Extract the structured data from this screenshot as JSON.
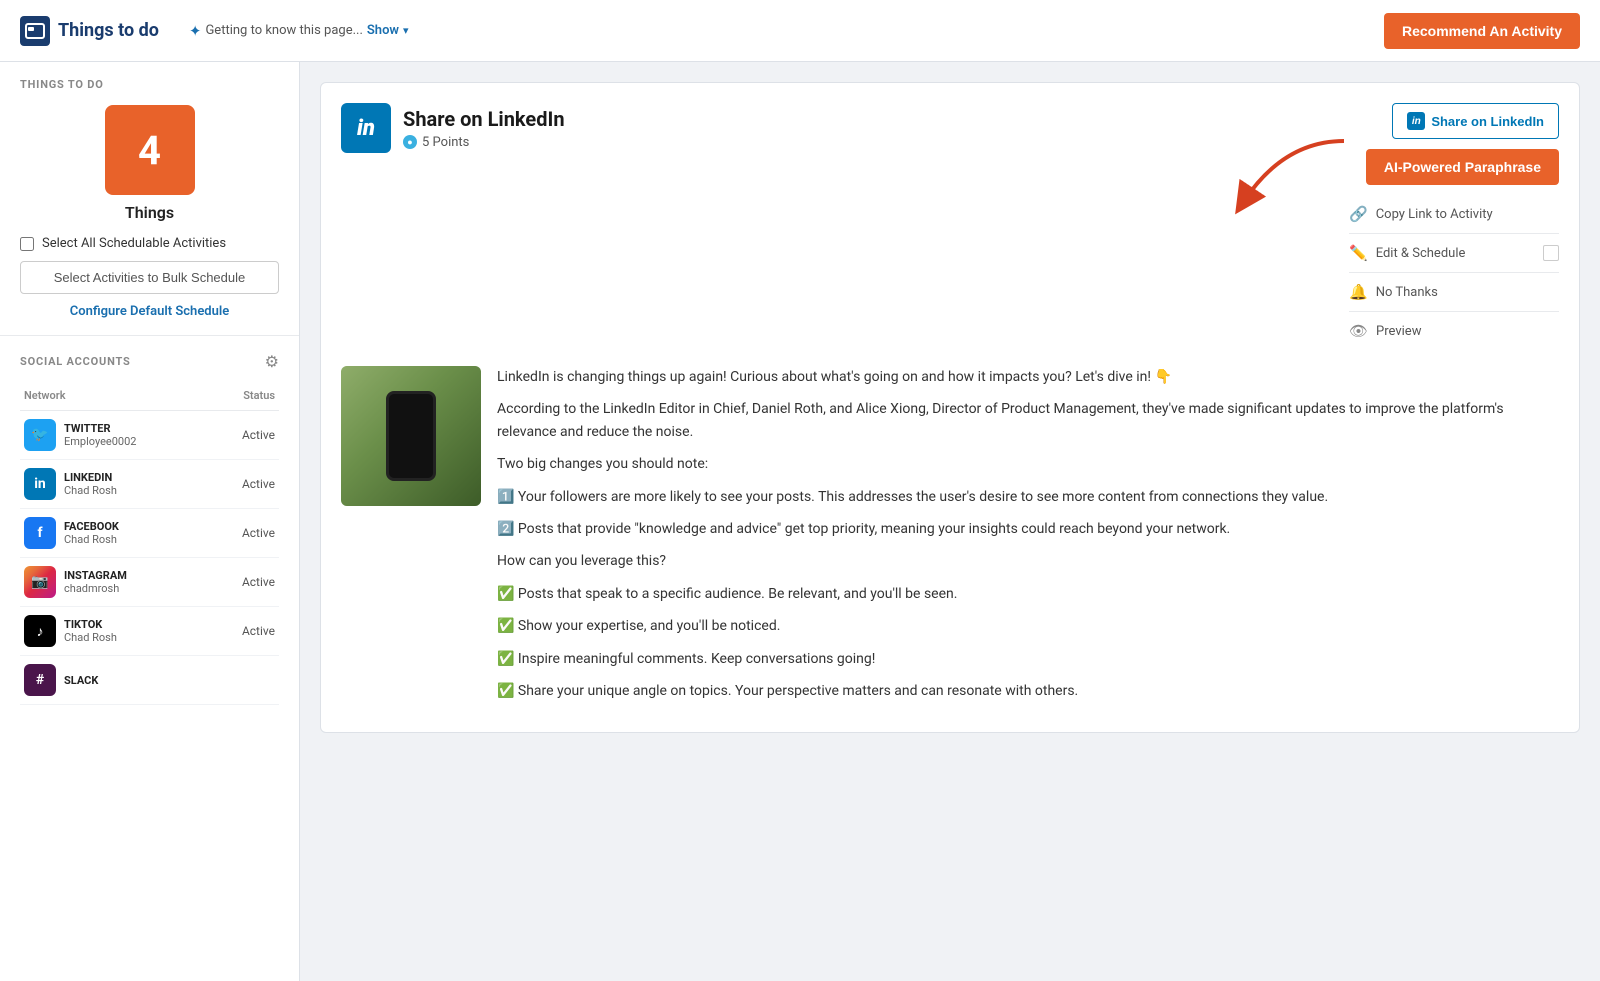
{
  "topNav": {
    "logoText": "Things to do",
    "hintText": "Getting to know this page...",
    "hintLink": "Show",
    "recommendBtn": "Recommend An Activity"
  },
  "sidebar": {
    "thingsToDo": {
      "sectionTitle": "THINGS TO DO",
      "count": "4",
      "countLabel": "Things",
      "selectAllLabel": "Select All Schedulable Activities",
      "bulkScheduleBtn": "Select Activities to Bulk Schedule",
      "configureLink": "Configure Default Schedule"
    },
    "socialAccounts": {
      "sectionTitle": "SOCIAL ACCOUNTS",
      "networkHeader": "Network",
      "statusHeader": "Status",
      "accounts": [
        {
          "platform": "twitter",
          "name": "TWITTER",
          "username": "Employee0002",
          "status": "Active"
        },
        {
          "platform": "linkedin",
          "name": "LINKEDIN",
          "username": "Chad Rosh",
          "status": "Active"
        },
        {
          "platform": "facebook",
          "name": "FACEBOOK",
          "username": "Chad Rosh",
          "status": "Active"
        },
        {
          "platform": "instagram",
          "name": "INSTAGRAM",
          "username": "chadmrosh",
          "status": "Active"
        },
        {
          "platform": "tiktok",
          "name": "TIKTOK",
          "username": "Chad Rosh",
          "status": "Active"
        },
        {
          "platform": "slack",
          "name": "SLACK",
          "username": "",
          "status": ""
        }
      ]
    }
  },
  "activity": {
    "platform": "LinkedIn",
    "title": "Share on LinkedIn",
    "points": "5 Points",
    "shareBtn": "Share on LinkedIn",
    "aiBtn": "AI-Powered Paraphrase",
    "copyLink": "Copy Link to Activity",
    "editSchedule": "Edit & Schedule",
    "noThanks": "No Thanks",
    "preview": "Preview",
    "content": {
      "p1": "LinkedIn is changing things up again! Curious about what's going on and how it impacts you? Let's dive in! 👇",
      "p2": "According to the LinkedIn Editor in Chief, Daniel Roth, and Alice Xiong, Director of Product Management, they've made significant updates to improve the platform's relevance and reduce the noise.",
      "p3": "Two big changes you should note:",
      "bullet1": "1️⃣ Your followers are more likely to see your posts. This addresses the user's desire to see more content from connections they value.",
      "bullet2": "2️⃣ Posts that provide \"knowledge and advice\" get top priority, meaning your insights could reach beyond your network.",
      "p4": "How can you leverage this?",
      "check1": "✅ Posts that speak to a specific audience. Be relevant, and you'll be seen.",
      "check2": "✅ Show your expertise, and you'll be noticed.",
      "check3": "✅ Inspire meaningful comments. Keep conversations going!",
      "check4": "✅ Share your unique angle on topics. Your perspective matters and can resonate with others."
    }
  }
}
